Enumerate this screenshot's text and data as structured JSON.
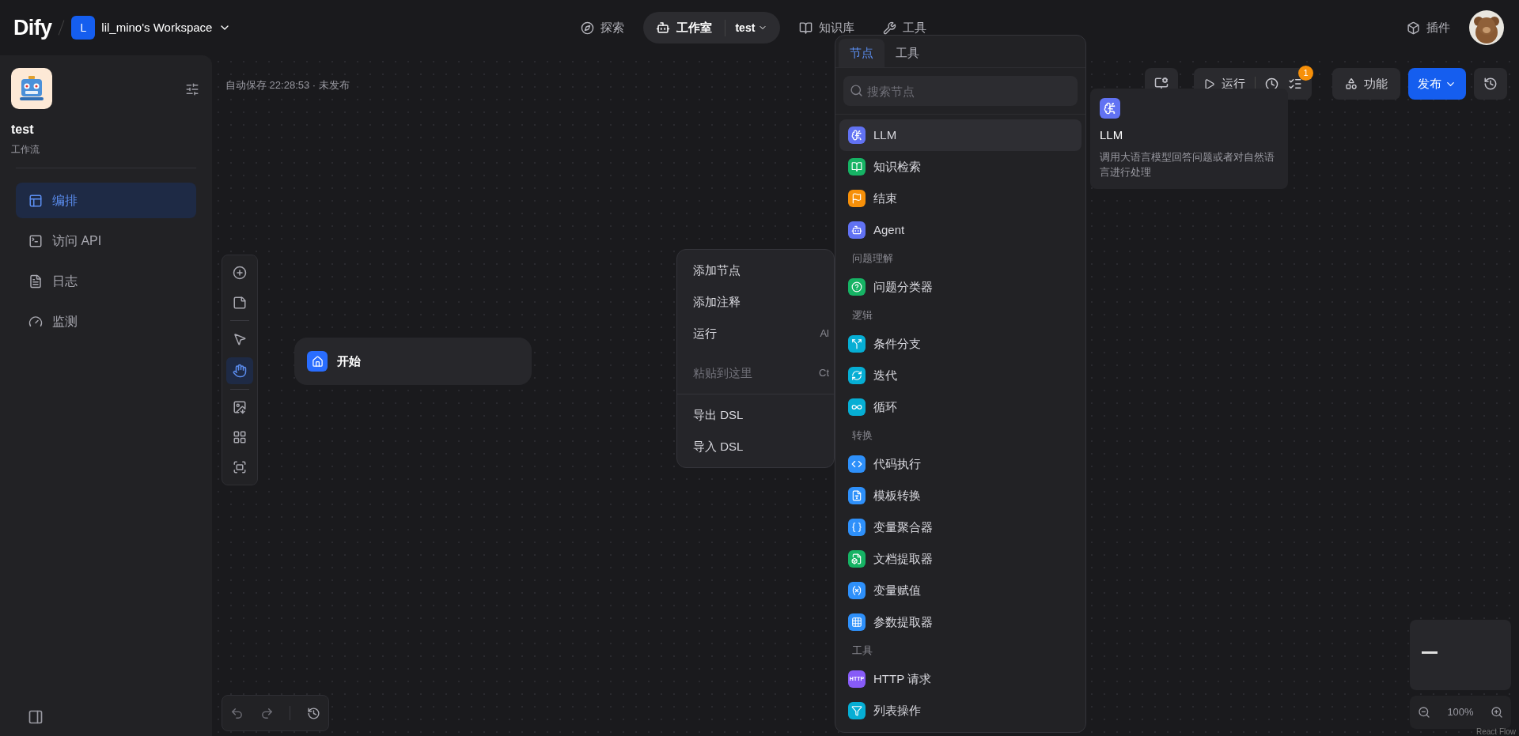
{
  "header": {
    "logo": "Dify",
    "workspace": {
      "initial": "L",
      "name": "lil_mino's Workspace"
    },
    "nav": [
      {
        "label": "探索",
        "selected": false
      },
      {
        "label": "工作室",
        "selected": true,
        "app": "test"
      },
      {
        "label": "知识库",
        "selected": false
      },
      {
        "label": "工具",
        "selected": false
      }
    ],
    "plugins": "插件"
  },
  "sidebar": {
    "app_name": "test",
    "app_type": "工作流",
    "items": [
      {
        "label": "编排",
        "selected": true
      },
      {
        "label": "访问 API",
        "selected": false
      },
      {
        "label": "日志",
        "selected": false
      },
      {
        "label": "监测",
        "selected": false
      }
    ]
  },
  "canvas": {
    "autosave": "自动保存 22:28:53 · 未发布",
    "modes": [
      {
        "selected": false
      },
      {
        "selected": true
      }
    ],
    "start_node": "开始",
    "context_menu": [
      {
        "label": "添加节点",
        "disabled": false
      },
      {
        "label": "添加注释",
        "disabled": false
      },
      {
        "label": "运行",
        "shortcut": "Al",
        "disabled": false
      },
      {
        "label": "粘贴到这里",
        "shortcut": "Ct",
        "disabled": true
      },
      {
        "kind": "divider"
      },
      {
        "label": "导出 DSL",
        "disabled": false
      },
      {
        "label": "导入 DSL",
        "disabled": false
      }
    ],
    "zoom": "100%",
    "attribution": "React Flow"
  },
  "toolbar": {
    "run": "运行",
    "badge": "1",
    "features": "功能",
    "publish": "发布"
  },
  "node_panel": {
    "tabs": [
      {
        "label": "节点",
        "selected": true
      },
      {
        "label": "工具",
        "selected": false
      }
    ],
    "search": {
      "placeholder": "搜索节点"
    },
    "items": [
      {
        "kind": "node",
        "label": "LLM",
        "color": "#6172f3",
        "highlighted": true
      },
      {
        "kind": "node",
        "label": "知识检索",
        "color": "#16b364",
        "highlighted": false
      },
      {
        "kind": "node",
        "label": "结束",
        "color": "#f79009",
        "highlighted": false
      },
      {
        "kind": "node",
        "label": "Agent",
        "color": "#6172f3",
        "highlighted": false
      },
      {
        "kind": "group",
        "label": "问题理解"
      },
      {
        "kind": "node",
        "label": "问题分类器",
        "color": "#16b364",
        "highlighted": false
      },
      {
        "kind": "group",
        "label": "逻辑"
      },
      {
        "kind": "node",
        "label": "条件分支",
        "color": "#06aed4",
        "highlighted": false
      },
      {
        "kind": "node",
        "label": "迭代",
        "color": "#06aed4",
        "highlighted": false
      },
      {
        "kind": "node",
        "label": "循环",
        "color": "#06aed4",
        "highlighted": false
      },
      {
        "kind": "group",
        "label": "转换"
      },
      {
        "kind": "node",
        "label": "代码执行",
        "color": "#2e90fa",
        "highlighted": false
      },
      {
        "kind": "node",
        "label": "模板转换",
        "color": "#2e90fa",
        "highlighted": false
      },
      {
        "kind": "node",
        "label": "变量聚合器",
        "color": "#2e90fa",
        "highlighted": false
      },
      {
        "kind": "node",
        "label": "文档提取器",
        "color": "#16b364",
        "highlighted": false
      },
      {
        "kind": "node",
        "label": "变量赋值",
        "color": "#2e90fa",
        "highlighted": false
      },
      {
        "kind": "node",
        "label": "参数提取器",
        "color": "#2e90fa",
        "highlighted": false
      },
      {
        "kind": "group",
        "label": "工具"
      },
      {
        "kind": "node",
        "label": "HTTP 请求",
        "color": "#875bf7",
        "highlighted": false,
        "icon_text": "HTTP"
      },
      {
        "kind": "node",
        "label": "列表操作",
        "color": "#06aed4",
        "highlighted": false
      }
    ]
  },
  "tooltip": {
    "title": "LLM",
    "color": "#6172f3",
    "description": "调用大语言模型回答问题或者对自然语言进行处理"
  }
}
